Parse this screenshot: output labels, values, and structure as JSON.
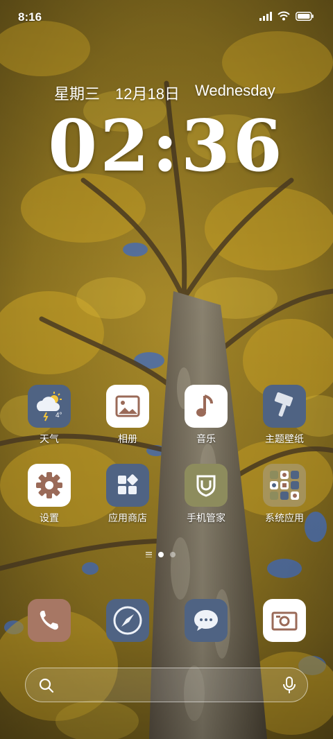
{
  "status_bar": {
    "time": "8:16"
  },
  "lockscreen": {
    "weekday": "星期三",
    "date": "12月18日",
    "weekday_en": "Wednesday",
    "clock": "02:36"
  },
  "apps": [
    {
      "label": "天气",
      "icon": "weather-icon",
      "temp": "4°"
    },
    {
      "label": "相册",
      "icon": "gallery-icon"
    },
    {
      "label": "音乐",
      "icon": "music-icon"
    },
    {
      "label": "主题壁纸",
      "icon": "theme-icon"
    },
    {
      "label": "设置",
      "icon": "gear-icon"
    },
    {
      "label": "应用商店",
      "icon": "app-store-icon"
    },
    {
      "label": "手机管家",
      "icon": "security-shield-icon"
    },
    {
      "label": "系统应用",
      "icon": "folder-icon"
    }
  ],
  "dock": [
    {
      "icon": "phone-icon"
    },
    {
      "icon": "compass-browser-icon"
    },
    {
      "icon": "message-icon"
    },
    {
      "icon": "camera-icon"
    }
  ],
  "search": {
    "placeholder": ""
  },
  "pager": {
    "pages": 2,
    "current": 1
  },
  "colors": {
    "icon_blue": "#4f6383",
    "icon_white": "#ffffff",
    "icon_brown": "#a77764",
    "icon_olive": "#8d8c5d",
    "accent_brown": "#9a6a58",
    "leaf_yellow": "#c9a226",
    "bark": "#6e6352"
  }
}
